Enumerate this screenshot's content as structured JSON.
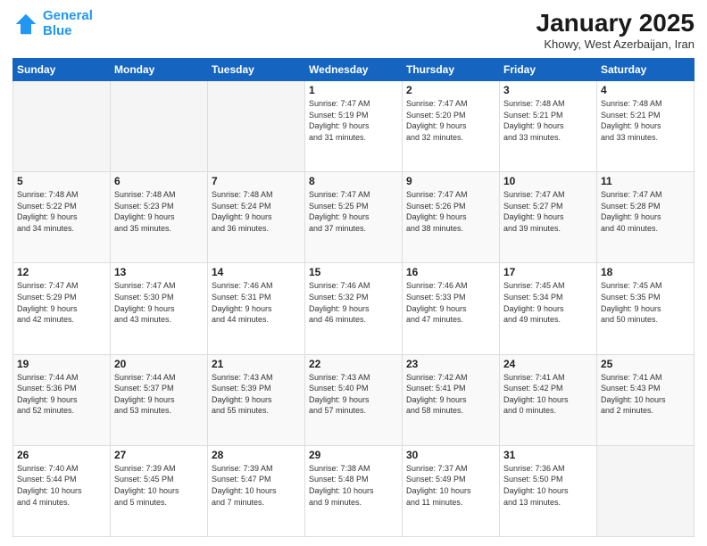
{
  "logo": {
    "line1": "General",
    "line2": "Blue"
  },
  "title": "January 2025",
  "subtitle": "Khowy, West Azerbaijan, Iran",
  "weekdays": [
    "Sunday",
    "Monday",
    "Tuesday",
    "Wednesday",
    "Thursday",
    "Friday",
    "Saturday"
  ],
  "weeks": [
    [
      {
        "day": "",
        "info": ""
      },
      {
        "day": "",
        "info": ""
      },
      {
        "day": "",
        "info": ""
      },
      {
        "day": "1",
        "info": "Sunrise: 7:47 AM\nSunset: 5:19 PM\nDaylight: 9 hours\nand 31 minutes."
      },
      {
        "day": "2",
        "info": "Sunrise: 7:47 AM\nSunset: 5:20 PM\nDaylight: 9 hours\nand 32 minutes."
      },
      {
        "day": "3",
        "info": "Sunrise: 7:48 AM\nSunset: 5:21 PM\nDaylight: 9 hours\nand 33 minutes."
      },
      {
        "day": "4",
        "info": "Sunrise: 7:48 AM\nSunset: 5:21 PM\nDaylight: 9 hours\nand 33 minutes."
      }
    ],
    [
      {
        "day": "5",
        "info": "Sunrise: 7:48 AM\nSunset: 5:22 PM\nDaylight: 9 hours\nand 34 minutes."
      },
      {
        "day": "6",
        "info": "Sunrise: 7:48 AM\nSunset: 5:23 PM\nDaylight: 9 hours\nand 35 minutes."
      },
      {
        "day": "7",
        "info": "Sunrise: 7:48 AM\nSunset: 5:24 PM\nDaylight: 9 hours\nand 36 minutes."
      },
      {
        "day": "8",
        "info": "Sunrise: 7:47 AM\nSunset: 5:25 PM\nDaylight: 9 hours\nand 37 minutes."
      },
      {
        "day": "9",
        "info": "Sunrise: 7:47 AM\nSunset: 5:26 PM\nDaylight: 9 hours\nand 38 minutes."
      },
      {
        "day": "10",
        "info": "Sunrise: 7:47 AM\nSunset: 5:27 PM\nDaylight: 9 hours\nand 39 minutes."
      },
      {
        "day": "11",
        "info": "Sunrise: 7:47 AM\nSunset: 5:28 PM\nDaylight: 9 hours\nand 40 minutes."
      }
    ],
    [
      {
        "day": "12",
        "info": "Sunrise: 7:47 AM\nSunset: 5:29 PM\nDaylight: 9 hours\nand 42 minutes."
      },
      {
        "day": "13",
        "info": "Sunrise: 7:47 AM\nSunset: 5:30 PM\nDaylight: 9 hours\nand 43 minutes."
      },
      {
        "day": "14",
        "info": "Sunrise: 7:46 AM\nSunset: 5:31 PM\nDaylight: 9 hours\nand 44 minutes."
      },
      {
        "day": "15",
        "info": "Sunrise: 7:46 AM\nSunset: 5:32 PM\nDaylight: 9 hours\nand 46 minutes."
      },
      {
        "day": "16",
        "info": "Sunrise: 7:46 AM\nSunset: 5:33 PM\nDaylight: 9 hours\nand 47 minutes."
      },
      {
        "day": "17",
        "info": "Sunrise: 7:45 AM\nSunset: 5:34 PM\nDaylight: 9 hours\nand 49 minutes."
      },
      {
        "day": "18",
        "info": "Sunrise: 7:45 AM\nSunset: 5:35 PM\nDaylight: 9 hours\nand 50 minutes."
      }
    ],
    [
      {
        "day": "19",
        "info": "Sunrise: 7:44 AM\nSunset: 5:36 PM\nDaylight: 9 hours\nand 52 minutes."
      },
      {
        "day": "20",
        "info": "Sunrise: 7:44 AM\nSunset: 5:37 PM\nDaylight: 9 hours\nand 53 minutes."
      },
      {
        "day": "21",
        "info": "Sunrise: 7:43 AM\nSunset: 5:39 PM\nDaylight: 9 hours\nand 55 minutes."
      },
      {
        "day": "22",
        "info": "Sunrise: 7:43 AM\nSunset: 5:40 PM\nDaylight: 9 hours\nand 57 minutes."
      },
      {
        "day": "23",
        "info": "Sunrise: 7:42 AM\nSunset: 5:41 PM\nDaylight: 9 hours\nand 58 minutes."
      },
      {
        "day": "24",
        "info": "Sunrise: 7:41 AM\nSunset: 5:42 PM\nDaylight: 10 hours\nand 0 minutes."
      },
      {
        "day": "25",
        "info": "Sunrise: 7:41 AM\nSunset: 5:43 PM\nDaylight: 10 hours\nand 2 minutes."
      }
    ],
    [
      {
        "day": "26",
        "info": "Sunrise: 7:40 AM\nSunset: 5:44 PM\nDaylight: 10 hours\nand 4 minutes."
      },
      {
        "day": "27",
        "info": "Sunrise: 7:39 AM\nSunset: 5:45 PM\nDaylight: 10 hours\nand 5 minutes."
      },
      {
        "day": "28",
        "info": "Sunrise: 7:39 AM\nSunset: 5:47 PM\nDaylight: 10 hours\nand 7 minutes."
      },
      {
        "day": "29",
        "info": "Sunrise: 7:38 AM\nSunset: 5:48 PM\nDaylight: 10 hours\nand 9 minutes."
      },
      {
        "day": "30",
        "info": "Sunrise: 7:37 AM\nSunset: 5:49 PM\nDaylight: 10 hours\nand 11 minutes."
      },
      {
        "day": "31",
        "info": "Sunrise: 7:36 AM\nSunset: 5:50 PM\nDaylight: 10 hours\nand 13 minutes."
      },
      {
        "day": "",
        "info": ""
      }
    ]
  ]
}
